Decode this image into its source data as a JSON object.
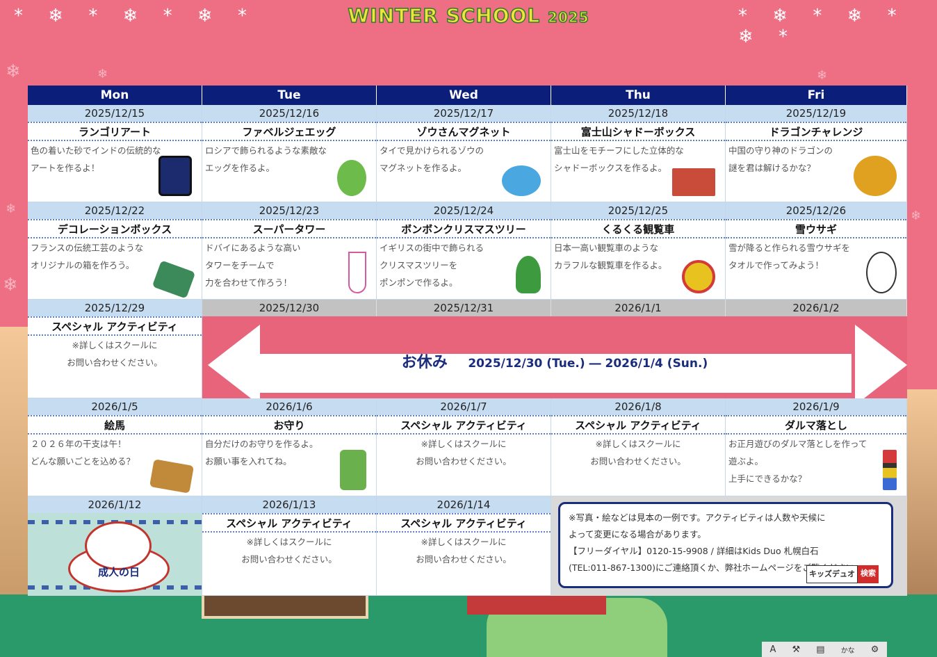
{
  "header": {
    "title": "WINTER SCHOOL",
    "year": "2025"
  },
  "weekdays": [
    "Mon",
    "Tue",
    "Wed",
    "Thu",
    "Fri"
  ],
  "week1": [
    {
      "date": "2025/12/15",
      "name": "ランゴリアート",
      "desc": "色の着いた砂でインドの伝統的な\nアートを作るよ！"
    },
    {
      "date": "2025/12/16",
      "name": "ファベルジェエッグ",
      "desc": "ロシアで飾られるような素敵な\nエッグを作るよ。"
    },
    {
      "date": "2025/12/17",
      "name": "ゾウさんマグネット",
      "desc": "タイで見かけられるゾウの\nマグネットを作るよ。"
    },
    {
      "date": "2025/12/18",
      "name": "富士山シャドーボックス",
      "desc": "富士山をモチーフにした立体的な\nシャドーボックスを作るよ。"
    },
    {
      "date": "2025/12/19",
      "name": "ドラゴンチャレンジ",
      "desc": "中国の守り神のドラゴンの\n謎を君は解けるかな？"
    }
  ],
  "week2": [
    {
      "date": "2025/12/22",
      "name": "デコレーションボックス",
      "desc": "フランスの伝統工芸のような\nオリジナルの箱を作ろう。"
    },
    {
      "date": "2025/12/23",
      "name": "スーパータワー",
      "desc": "ドバイにあるような高い\nタワーをチームで\n力を合わせて作ろう！"
    },
    {
      "date": "2025/12/24",
      "name": "ボンボンクリスマスツリー",
      "desc": "イギリスの街中で飾られる\nクリスマスツリーを\nポンポンで作るよ。"
    },
    {
      "date": "2025/12/25",
      "name": "くるくる観覧車",
      "desc": "日本一高い観覧車のような\nカラフルな観覧車を作るよ。"
    },
    {
      "date": "2025/12/26",
      "name": "雪ウサギ",
      "desc": "雪が降ると作られる雪ウサギを\nタオルで作ってみよう！"
    }
  ],
  "week3": {
    "first": {
      "date": "2025/12/29",
      "name": "スペシャル アクティビティ",
      "desc": "※詳しくはスクールに\nお問い合わせください。"
    },
    "holiday_dates": [
      "2025/12/30",
      "2025/12/31",
      "2026/1/1",
      "2026/1/2"
    ],
    "holiday_label": "お休み",
    "holiday_range": "2025/12/30 (Tue.) ― 2026/1/4 (Sun.)"
  },
  "week4": [
    {
      "date": "2026/1/5",
      "name": "絵馬",
      "desc": "２０２６年の干支は午！\nどんな願いごとを込める？"
    },
    {
      "date": "2026/1/6",
      "name": "お守り",
      "desc": "自分だけのお守りを作るよ。\nお願い事を入れてね。"
    },
    {
      "date": "2026/1/7",
      "name": "スペシャル アクティビティ",
      "desc": "※詳しくはスクールに\nお問い合わせください。"
    },
    {
      "date": "2026/1/8",
      "name": "スペシャル アクティビティ",
      "desc": "※詳しくはスクールに\nお問い合わせください。"
    },
    {
      "date": "2026/1/9",
      "name": "ダルマ落とし",
      "desc": "お正月遊びのダルマ落としを作って\n遊ぶよ。\n上手にできるかな？"
    }
  ],
  "week5": {
    "seijin": {
      "date": "2026/1/12",
      "label": "成人の日"
    },
    "days": [
      {
        "date": "2026/1/13",
        "name": "スペシャル アクティビティ",
        "desc": "※詳しくはスクールに\nお問い合わせください。"
      },
      {
        "date": "2026/1/14",
        "name": "スペシャル アクティビティ",
        "desc": "※詳しくはスクールに\nお問い合わせください。"
      }
    ]
  },
  "notice": {
    "text": "※写真・絵などは見本の一例です。アクティビティは人数や天候に\nよって変更になる場合があります。\n【フリーダイヤル】0120-15-9908 / 詳細はKids Duo 札幌白石\n(TEL:011-867-1300)にご連絡頂くか、弊社ホームページをご覧ください。",
    "search_keyword": "キッズデュオ",
    "search_button": "検索"
  },
  "toolbar": {
    "kana": "かな"
  },
  "colors": {
    "header_navy": "#0b1f7a",
    "date_blue": "#c6dcf1",
    "background_pink": "#ee6f84"
  }
}
